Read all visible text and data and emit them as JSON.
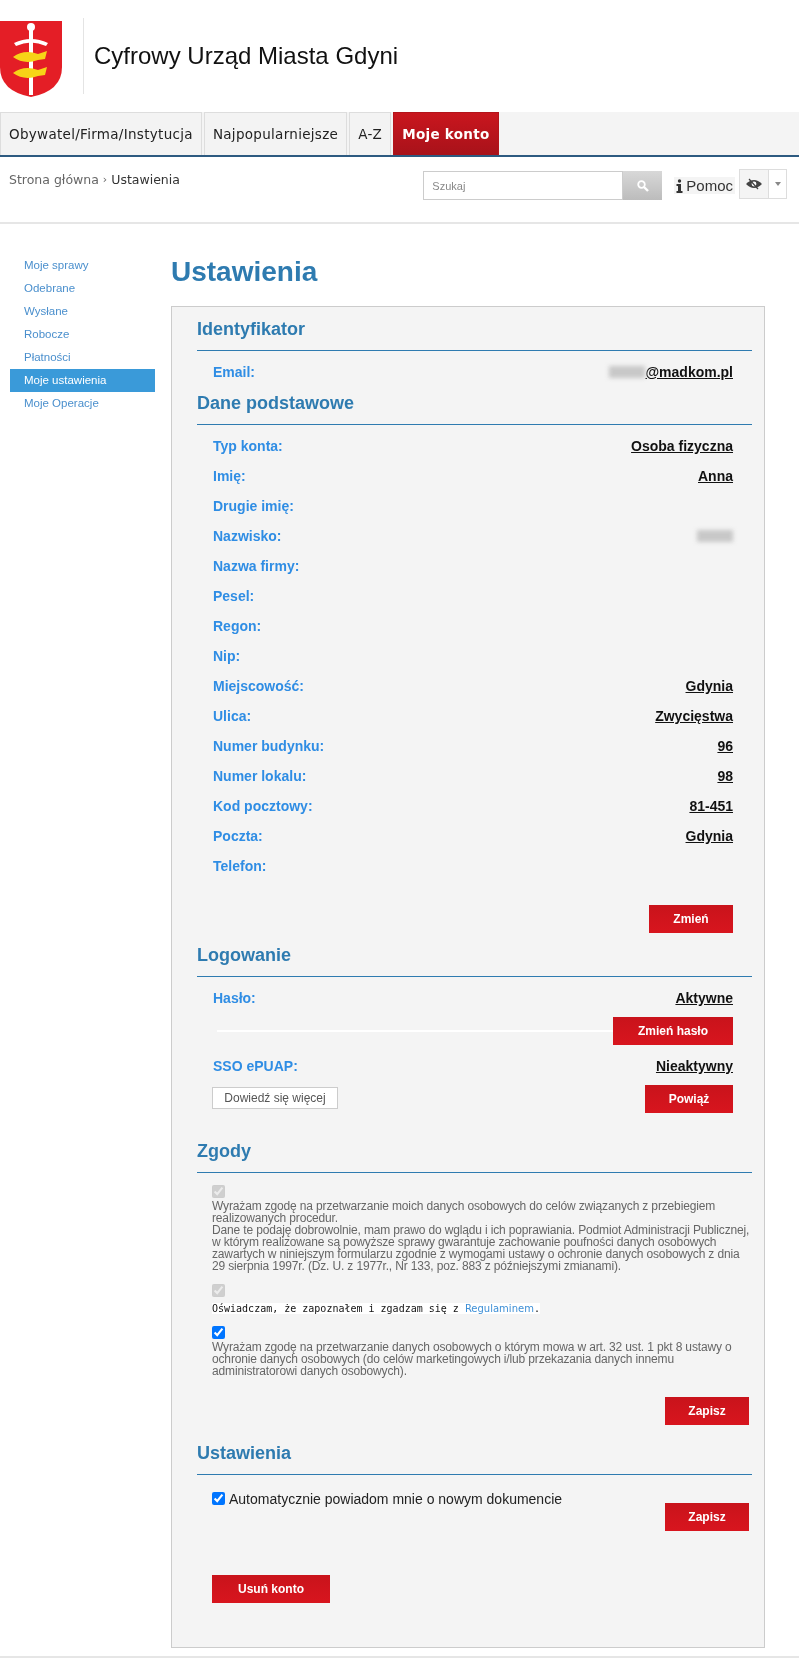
{
  "header": {
    "title": "Cyfrowy Urząd Miasta Gdyni"
  },
  "nav": [
    {
      "label": "Obywatel/Firma/Instytucja",
      "selected": false
    },
    {
      "label": "Najpopularniejsze",
      "selected": false
    },
    {
      "label": "A-Z",
      "selected": false
    },
    {
      "label": "Moje konto",
      "selected": true
    }
  ],
  "breadcrumb": {
    "home": "Strona główna",
    "separator": "›",
    "current": "Ustawienia"
  },
  "search": {
    "placeholder": "Szukaj"
  },
  "help": {
    "label": "Pomoc"
  },
  "sidebar": {
    "items": [
      {
        "label": "Moje sprawy",
        "selected": false
      },
      {
        "label": "Odebrane",
        "selected": false
      },
      {
        "label": "Wysłane",
        "selected": false
      },
      {
        "label": "Robocze",
        "selected": false
      },
      {
        "label": "Płatności",
        "selected": false
      },
      {
        "label": "Moje ustawienia",
        "selected": true
      },
      {
        "label": "Moje Operacje",
        "selected": false
      }
    ]
  },
  "page_title": "Ustawienia",
  "identifier": {
    "heading": "Identyfikator",
    "rows": [
      {
        "label": "Email:",
        "value": "@madkom.pl",
        "redacted": true
      }
    ]
  },
  "basic_data": {
    "heading": "Dane podstawowe",
    "rows": [
      {
        "label": "Typ konta:",
        "value": "Osoba fizyczna"
      },
      {
        "label": "Imię:",
        "value": "Anna"
      },
      {
        "label": "Drugie imię:"
      },
      {
        "label": "Nazwisko:",
        "redacted": true
      },
      {
        "label": "Nazwa firmy:"
      },
      {
        "label": "Pesel:"
      },
      {
        "label": "Regon:"
      },
      {
        "label": "Nip:"
      },
      {
        "label": "Miejscowość:",
        "value": "Gdynia"
      },
      {
        "label": "Ulica:",
        "value": "Zwycięstwa"
      },
      {
        "label": "Numer budynku:",
        "value": "96"
      },
      {
        "label": "Numer lokalu:",
        "value": "98"
      },
      {
        "label": "Kod pocztowy:",
        "value": "81-451"
      },
      {
        "label": "Poczta:",
        "value": "Gdynia"
      },
      {
        "label": "Telefon:"
      }
    ],
    "button": "Zmień"
  },
  "login": {
    "heading": "Logowanie",
    "password": {
      "label": "Hasło:",
      "value": "Aktywne",
      "button": "Zmień hasło"
    },
    "sso": {
      "label": "SSO ePUAP:",
      "value": "Nieaktywny",
      "more_button": "Dowiedź się więcej",
      "button": "Powiąż"
    }
  },
  "consents": {
    "heading": "Zgody",
    "items": [
      {
        "kind": "plain",
        "checked": true,
        "disabled": true,
        "text": "Wyrażam zgodę na przetwarzanie moich danych osobowych do celów związanych z przebiegiem realizowanych procedur.\nDane te podaję dobrowolnie, mam prawo do wglądu i ich poprawiania. Podmiot Administracji Publicznej, w którym realizowane są powyższe sprawy gwarantuje zachowanie poufności danych osobowych zawartych w niniejszym formularzu zgodnie z wymogami ustawy o ochronie danych osobowych z dnia 29 sierpnia 1997r. (Dz. U. z 1977r., Nr 133, poz. 883 z późniejszymi zmianami)."
      },
      {
        "kind": "terms",
        "checked": true,
        "disabled": true,
        "text": "Oświadczam, że zapoznałem i zgadzam się z ",
        "link": "Regulaminem",
        "tail": "."
      },
      {
        "kind": "plain",
        "checked": true,
        "disabled": false,
        "text": "Wyrażam zgodę na przetwarzanie danych osobowych o którym mowa w art. 32 ust. 1 pkt 8 ustawy o ochronie danych osobowych (do celów marketingowych i/lub przekazania danych innemu administratorowi danych osobowych)."
      }
    ],
    "button": "Zapisz"
  },
  "settings": {
    "heading": "Ustawienia",
    "option": {
      "label": "Automatycznie powiadom mnie o nowym dokumencie",
      "checked": true
    },
    "button": "Zapisz",
    "delete_button": "Usuń konto"
  }
}
